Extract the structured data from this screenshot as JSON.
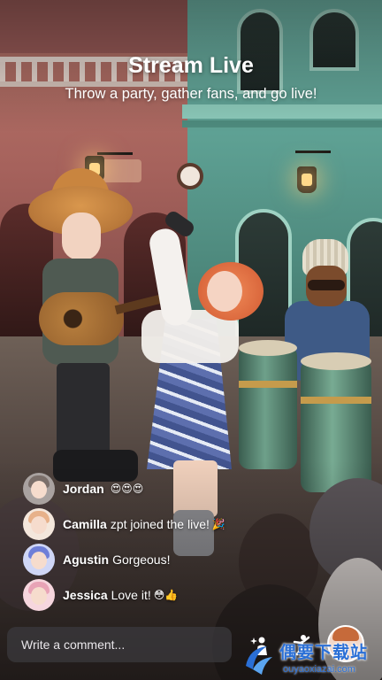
{
  "header": {
    "title": "Stream Live",
    "subtitle": "Throw a party, gather fans, and go live!"
  },
  "chat": [
    {
      "name": "Jordan",
      "message": "",
      "emoji": "😍😍😍",
      "avatar_hair": "#7b6f6a"
    },
    {
      "name": "Camilla",
      "message": "zpt joined the live!",
      "emoji": "🎉",
      "avatar_hair": "#e7b18a"
    },
    {
      "name": "Agustin",
      "message": "Gorgeous!",
      "emoji": "",
      "avatar_hair": "#6f7fd8"
    },
    {
      "name": "Jessica",
      "message": "Love it!",
      "emoji": "😳👍",
      "avatar_hair": "#e8a3b6"
    }
  ],
  "comment": {
    "placeholder": "Write a comment..."
  },
  "actions": [
    {
      "icon": "sparkle-person-icon"
    },
    {
      "icon": "dance-icon"
    },
    {
      "icon": "profile-avatar-icon"
    }
  ],
  "watermark": {
    "text": "偶要下载站",
    "url_text": "ouyaoxiazai.com"
  },
  "colors": {
    "accent": "#2a6fd6",
    "comment_bg": "#3c3a3e"
  }
}
